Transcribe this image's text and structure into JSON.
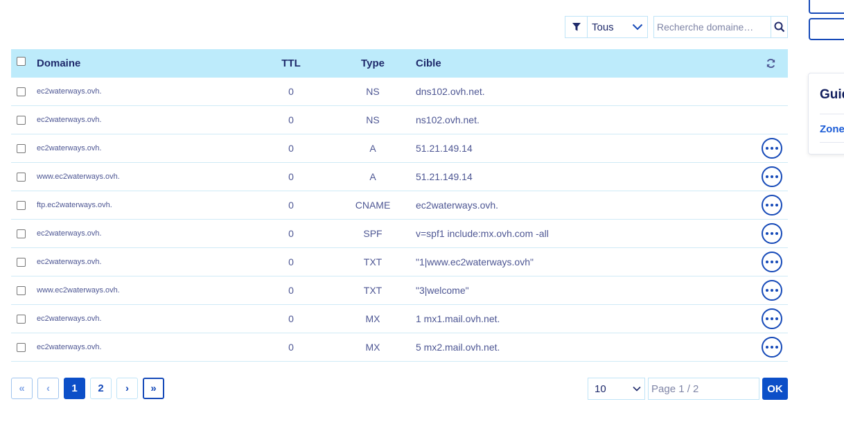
{
  "filter": {
    "selected": "Tous"
  },
  "search": {
    "placeholder": "Recherche domaine…"
  },
  "sidebar": {
    "guide_title": "Guides",
    "link": "Zone DNS"
  },
  "table": {
    "headers": {
      "domain": "Domaine",
      "ttl": "TTL",
      "type": "Type",
      "target": "Cible"
    },
    "rows": [
      {
        "domain": "ec2waterways.ovh.",
        "ttl": "0",
        "type": "NS",
        "target": "dns102.ovh.net."
      },
      {
        "domain": "ec2waterways.ovh.",
        "ttl": "0",
        "type": "NS",
        "target": "ns102.ovh.net."
      },
      {
        "domain": "ec2waterways.ovh.",
        "ttl": "0",
        "type": "A",
        "target": "51.21.149.14"
      },
      {
        "domain": "www.ec2waterways.ovh.",
        "ttl": "0",
        "type": "A",
        "target": "51.21.149.14"
      },
      {
        "domain": "ftp.ec2waterways.ovh.",
        "ttl": "0",
        "type": "CNAME",
        "target": "ec2waterways.ovh."
      },
      {
        "domain": "ec2waterways.ovh.",
        "ttl": "0",
        "type": "SPF",
        "target": "v=spf1 include:mx.ovh.com -all"
      },
      {
        "domain": "ec2waterways.ovh.",
        "ttl": "0",
        "type": "TXT",
        "target": "\"1|www.ec2waterways.ovh\""
      },
      {
        "domain": "www.ec2waterways.ovh.",
        "ttl": "0",
        "type": "TXT",
        "target": "\"3|welcome\""
      },
      {
        "domain": "ec2waterways.ovh.",
        "ttl": "0",
        "type": "MX",
        "target": "1 mx1.mail.ovh.net."
      },
      {
        "domain": "ec2waterways.ovh.",
        "ttl": "0",
        "type": "MX",
        "target": "5 mx2.mail.ovh.net."
      }
    ]
  },
  "pagination": {
    "first": "«",
    "prev": "‹",
    "pages": [
      "1",
      "2"
    ],
    "next": "›",
    "last": "»",
    "per_page": "10",
    "page_placeholder": "Page 1 / 2",
    "ok_label": "OK"
  }
}
